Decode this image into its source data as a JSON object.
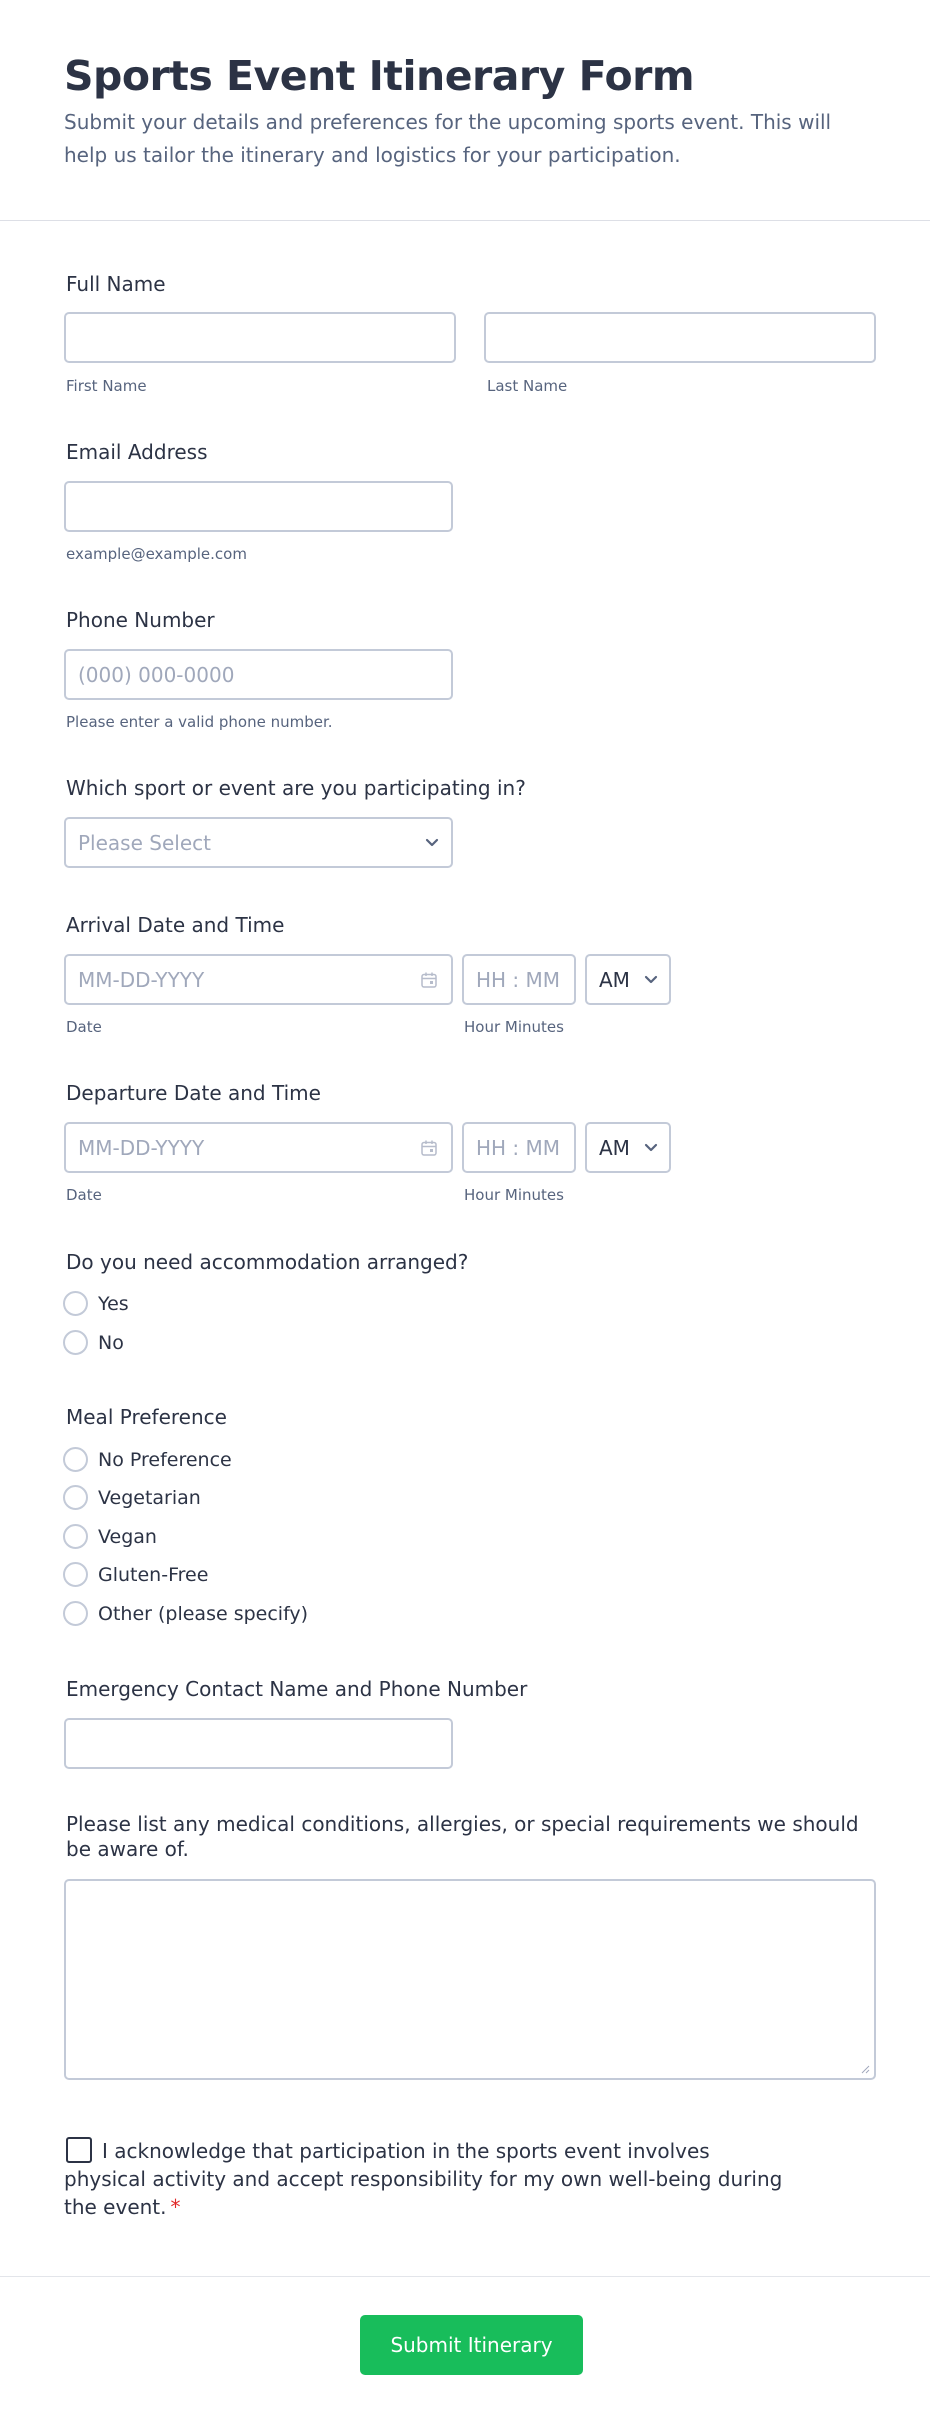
{
  "header": {
    "title": "Sports Event Itinerary Form",
    "subtitle": "Submit your details and preferences for the upcoming sports event. This will help us tailor the itinerary and logistics for your participation."
  },
  "full_name": {
    "label": "Full Name",
    "first_sublabel": "First Name",
    "last_sublabel": "Last Name",
    "first_value": "",
    "last_value": ""
  },
  "email": {
    "label": "Email Address",
    "sublabel": "example@example.com",
    "value": ""
  },
  "phone": {
    "label": "Phone Number",
    "placeholder": "(000) 000-0000",
    "sublabel": "Please enter a valid phone number."
  },
  "sport": {
    "label": "Which sport or event are you participating in?",
    "selected": "Please Select"
  },
  "arrival": {
    "label": "Arrival Date and Time",
    "date_placeholder": "MM-DD-YYYY",
    "time_placeholder": "HH : MM",
    "ampm": "AM",
    "date_sublabel": "Date",
    "time_sublabel": "Hour Minutes"
  },
  "departure": {
    "label": "Departure Date and Time",
    "date_placeholder": "MM-DD-YYYY",
    "time_placeholder": "HH : MM",
    "ampm": "AM",
    "date_sublabel": "Date",
    "time_sublabel": "Hour Minutes"
  },
  "accommodation": {
    "label": "Do you need accommodation arranged?",
    "options": [
      "Yes",
      "No"
    ]
  },
  "meal": {
    "label": "Meal Preference",
    "options": [
      "No Preference",
      "Vegetarian",
      "Vegan",
      "Gluten-Free",
      "Other (please specify)"
    ]
  },
  "emergency": {
    "label": "Emergency Contact Name and Phone Number",
    "value": ""
  },
  "medical": {
    "label": "Please list any medical conditions, allergies, or special requirements we should be aware of.",
    "value": ""
  },
  "acknowledge": {
    "text": "I acknowledge that participation in the sports event involves physical activity and accept responsibility for my own well-being during the event.",
    "required_mark": "*"
  },
  "submit": {
    "label": "Submit Itinerary",
    "color": "#18bd5b"
  },
  "icons": {
    "calendar": "calendar-icon",
    "dropdown": "chevron-down-icon"
  }
}
